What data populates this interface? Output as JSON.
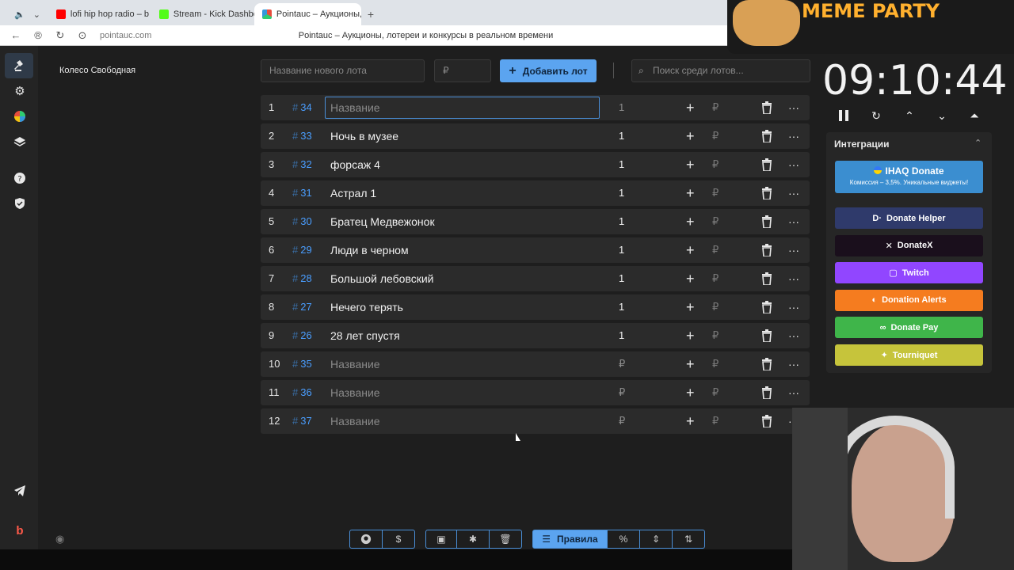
{
  "browser": {
    "tabs": [
      {
        "title": "lofi hip hop radio – b"
      },
      {
        "title": "Stream - Kick Dashboard"
      },
      {
        "title": "Pointauc – Аукционы, ло"
      }
    ],
    "url": "pointauc.com",
    "page_title": "Pointauc – Аукционы, лотереи и конкурсы в реальном времени"
  },
  "sidebar": {
    "wheel_link": "Колесо Свободная"
  },
  "toolbar": {
    "new_lot_placeholder": "Название нового лота",
    "amount_placeholder": "₽",
    "add_label": "Добавить лот",
    "search_placeholder": "Поиск среди лотов..."
  },
  "lots": [
    {
      "num": "1",
      "id": "34",
      "name": "Название",
      "amount": "1",
      "placeholder": true,
      "editing": true
    },
    {
      "num": "2",
      "id": "33",
      "name": "Ночь в музее",
      "amount": "1"
    },
    {
      "num": "3",
      "id": "32",
      "name": "форсаж 4",
      "amount": "1"
    },
    {
      "num": "4",
      "id": "31",
      "name": "Астрал 1",
      "amount": "1"
    },
    {
      "num": "5",
      "id": "30",
      "name": "Братец Медвежонок",
      "amount": "1"
    },
    {
      "num": "6",
      "id": "29",
      "name": "Люди в черном",
      "amount": "1"
    },
    {
      "num": "7",
      "id": "28",
      "name": "Большой лебовский",
      "amount": "1"
    },
    {
      "num": "8",
      "id": "27",
      "name": "Нечего терять",
      "amount": "1"
    },
    {
      "num": "9",
      "id": "26",
      "name": "28 лет спустя",
      "amount": "1"
    },
    {
      "num": "10",
      "id": "35",
      "name": "Название",
      "amount": "₽",
      "placeholder": true
    },
    {
      "num": "11",
      "id": "36",
      "name": "Название",
      "amount": "₽",
      "placeholder": true
    },
    {
      "num": "12",
      "id": "37",
      "name": "Название",
      "amount": "₽",
      "placeholder": true
    }
  ],
  "lot_controls": {
    "hash": "#",
    "plus": "+",
    "currency": "₽",
    "more": "···"
  },
  "timer": {
    "value": "09:10:44"
  },
  "integrations": {
    "title": "Интеграции",
    "ihaq": {
      "title": "IHAQ Donate",
      "subtitle": "Комиссия – 3,5%. Уникальные виджеты!"
    },
    "buttons": [
      {
        "label": "Donate Helper",
        "color": "#2f3a6b"
      },
      {
        "label": "DonateX",
        "color": "#1a0f1c"
      },
      {
        "label": "Twitch",
        "color": "#9146ff"
      },
      {
        "label": "Donation Alerts",
        "color": "#f57c1f"
      },
      {
        "label": "Donate Pay",
        "color": "#3fb54a"
      },
      {
        "label": "Tourniquet",
        "color": "#c6c43b"
      }
    ]
  },
  "bottom_bar": {
    "rules_label": "Правила",
    "percent_label": "%"
  },
  "overlay": {
    "meme_text": "MEME PARTY"
  },
  "colors": {
    "accent": "#5ba4f0",
    "id_blue": "#4a9eff"
  }
}
